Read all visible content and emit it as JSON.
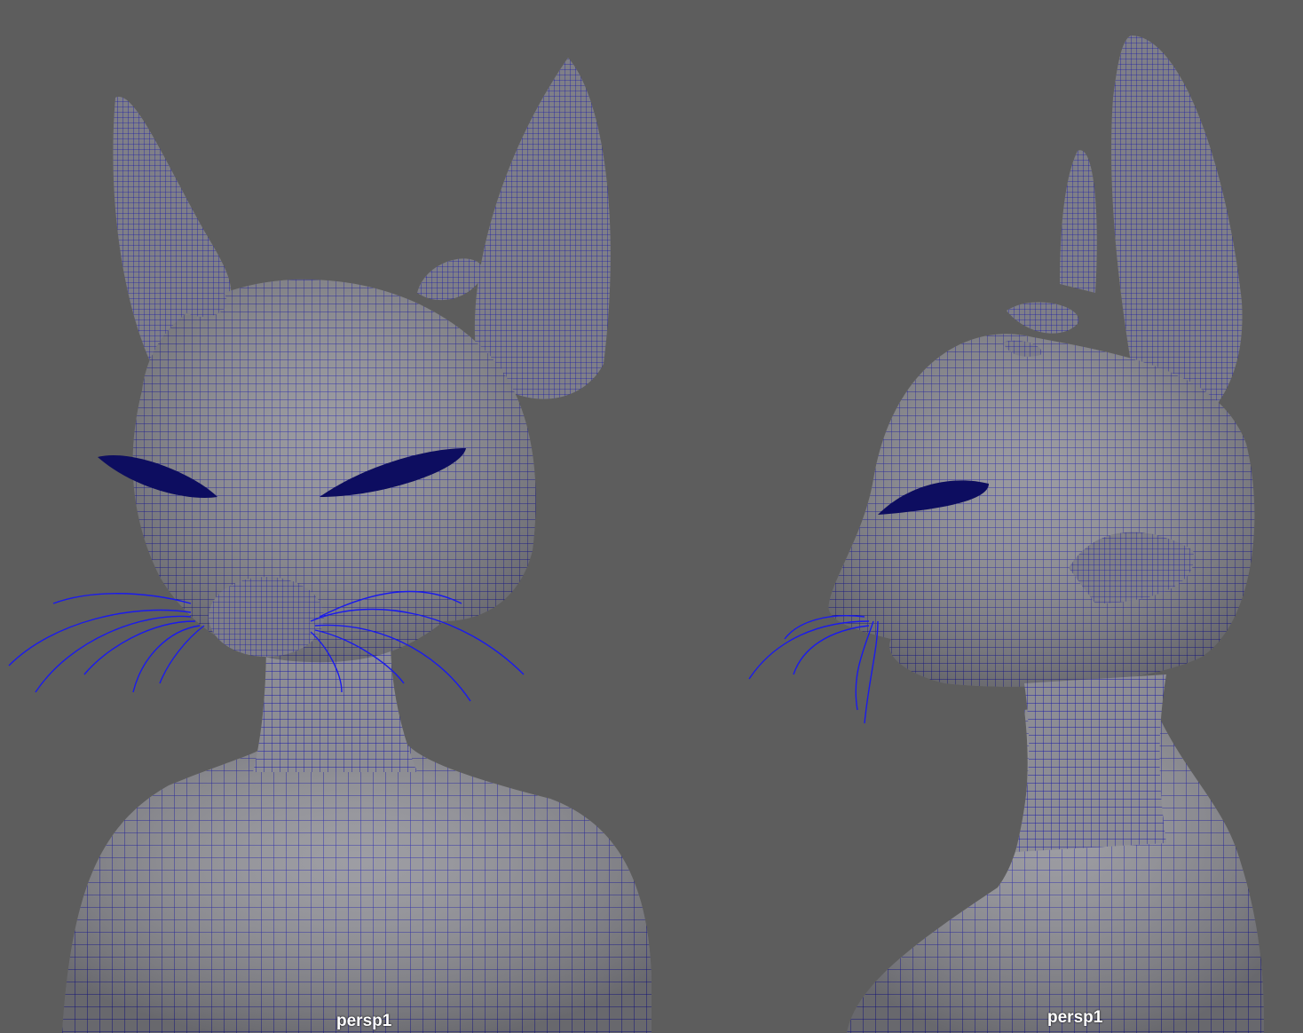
{
  "viewports": [
    {
      "camera_label": "persp1",
      "view": "front"
    },
    {
      "camera_label": "persp1",
      "view": "profile"
    }
  ],
  "colors": {
    "background": "#5d5d5d",
    "mesh_fill": "#8e8e96",
    "wire": "#1a1aa8",
    "label": "#ffffff"
  },
  "icons": [
    "wireframe-mesh",
    "whiskers"
  ]
}
